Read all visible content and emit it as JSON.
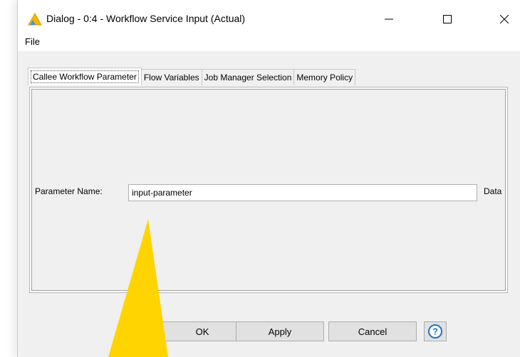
{
  "window": {
    "title": "Dialog - 0:4 - Workflow Service Input (Actual)",
    "icon": "warning-triangle-icon",
    "controls": {
      "minimize_icon": "minimize-icon",
      "maximize_icon": "maximize-icon",
      "close_icon": "close-icon"
    }
  },
  "menu": {
    "items": [
      "File"
    ]
  },
  "tabs": [
    {
      "label": "Callee Workflow Parameter",
      "active": true
    },
    {
      "label": "Flow Variables",
      "active": false
    },
    {
      "label": "Job Manager Selection",
      "active": false
    },
    {
      "label": "Memory Policy",
      "active": false
    }
  ],
  "form": {
    "parameter_label": "Parameter Name:",
    "parameter_value": "input-parameter",
    "data_label": "Data"
  },
  "buttons": {
    "ok": "OK",
    "apply": "Apply",
    "cancel": "Cancel",
    "help_icon": "help-icon"
  },
  "colors": {
    "title_icon_fill": "#f5b800",
    "title_icon_accent": "#4a90d9",
    "help_blue": "#1e73c8",
    "annotation_arrow": "#ffd400"
  }
}
